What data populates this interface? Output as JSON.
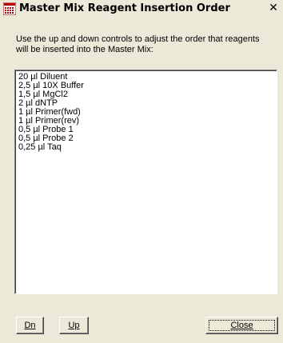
{
  "window": {
    "title": "Master Mix Reagent Insertion Order",
    "close_glyph": "✕"
  },
  "instructions": "Use the up and down controls to adjust the order that reagents will be inserted into the Master Mix:",
  "reagents": [
    "20 µl Diluent",
    "2,5 µl 10X Buffer",
    "1,5 µl MgCl2",
    "2 µl dNTP",
    "1 µl Primer(fwd)",
    "1 µl Primer(rev)",
    "0,5 µl Probe 1",
    "0,5 µl Probe 2",
    "0,25 µl Taq"
  ],
  "buttons": {
    "down_label": "Dn",
    "up_label": "Up",
    "close_label": "Close"
  },
  "icons": {
    "app": "grid-app-icon",
    "close": "close-icon"
  }
}
